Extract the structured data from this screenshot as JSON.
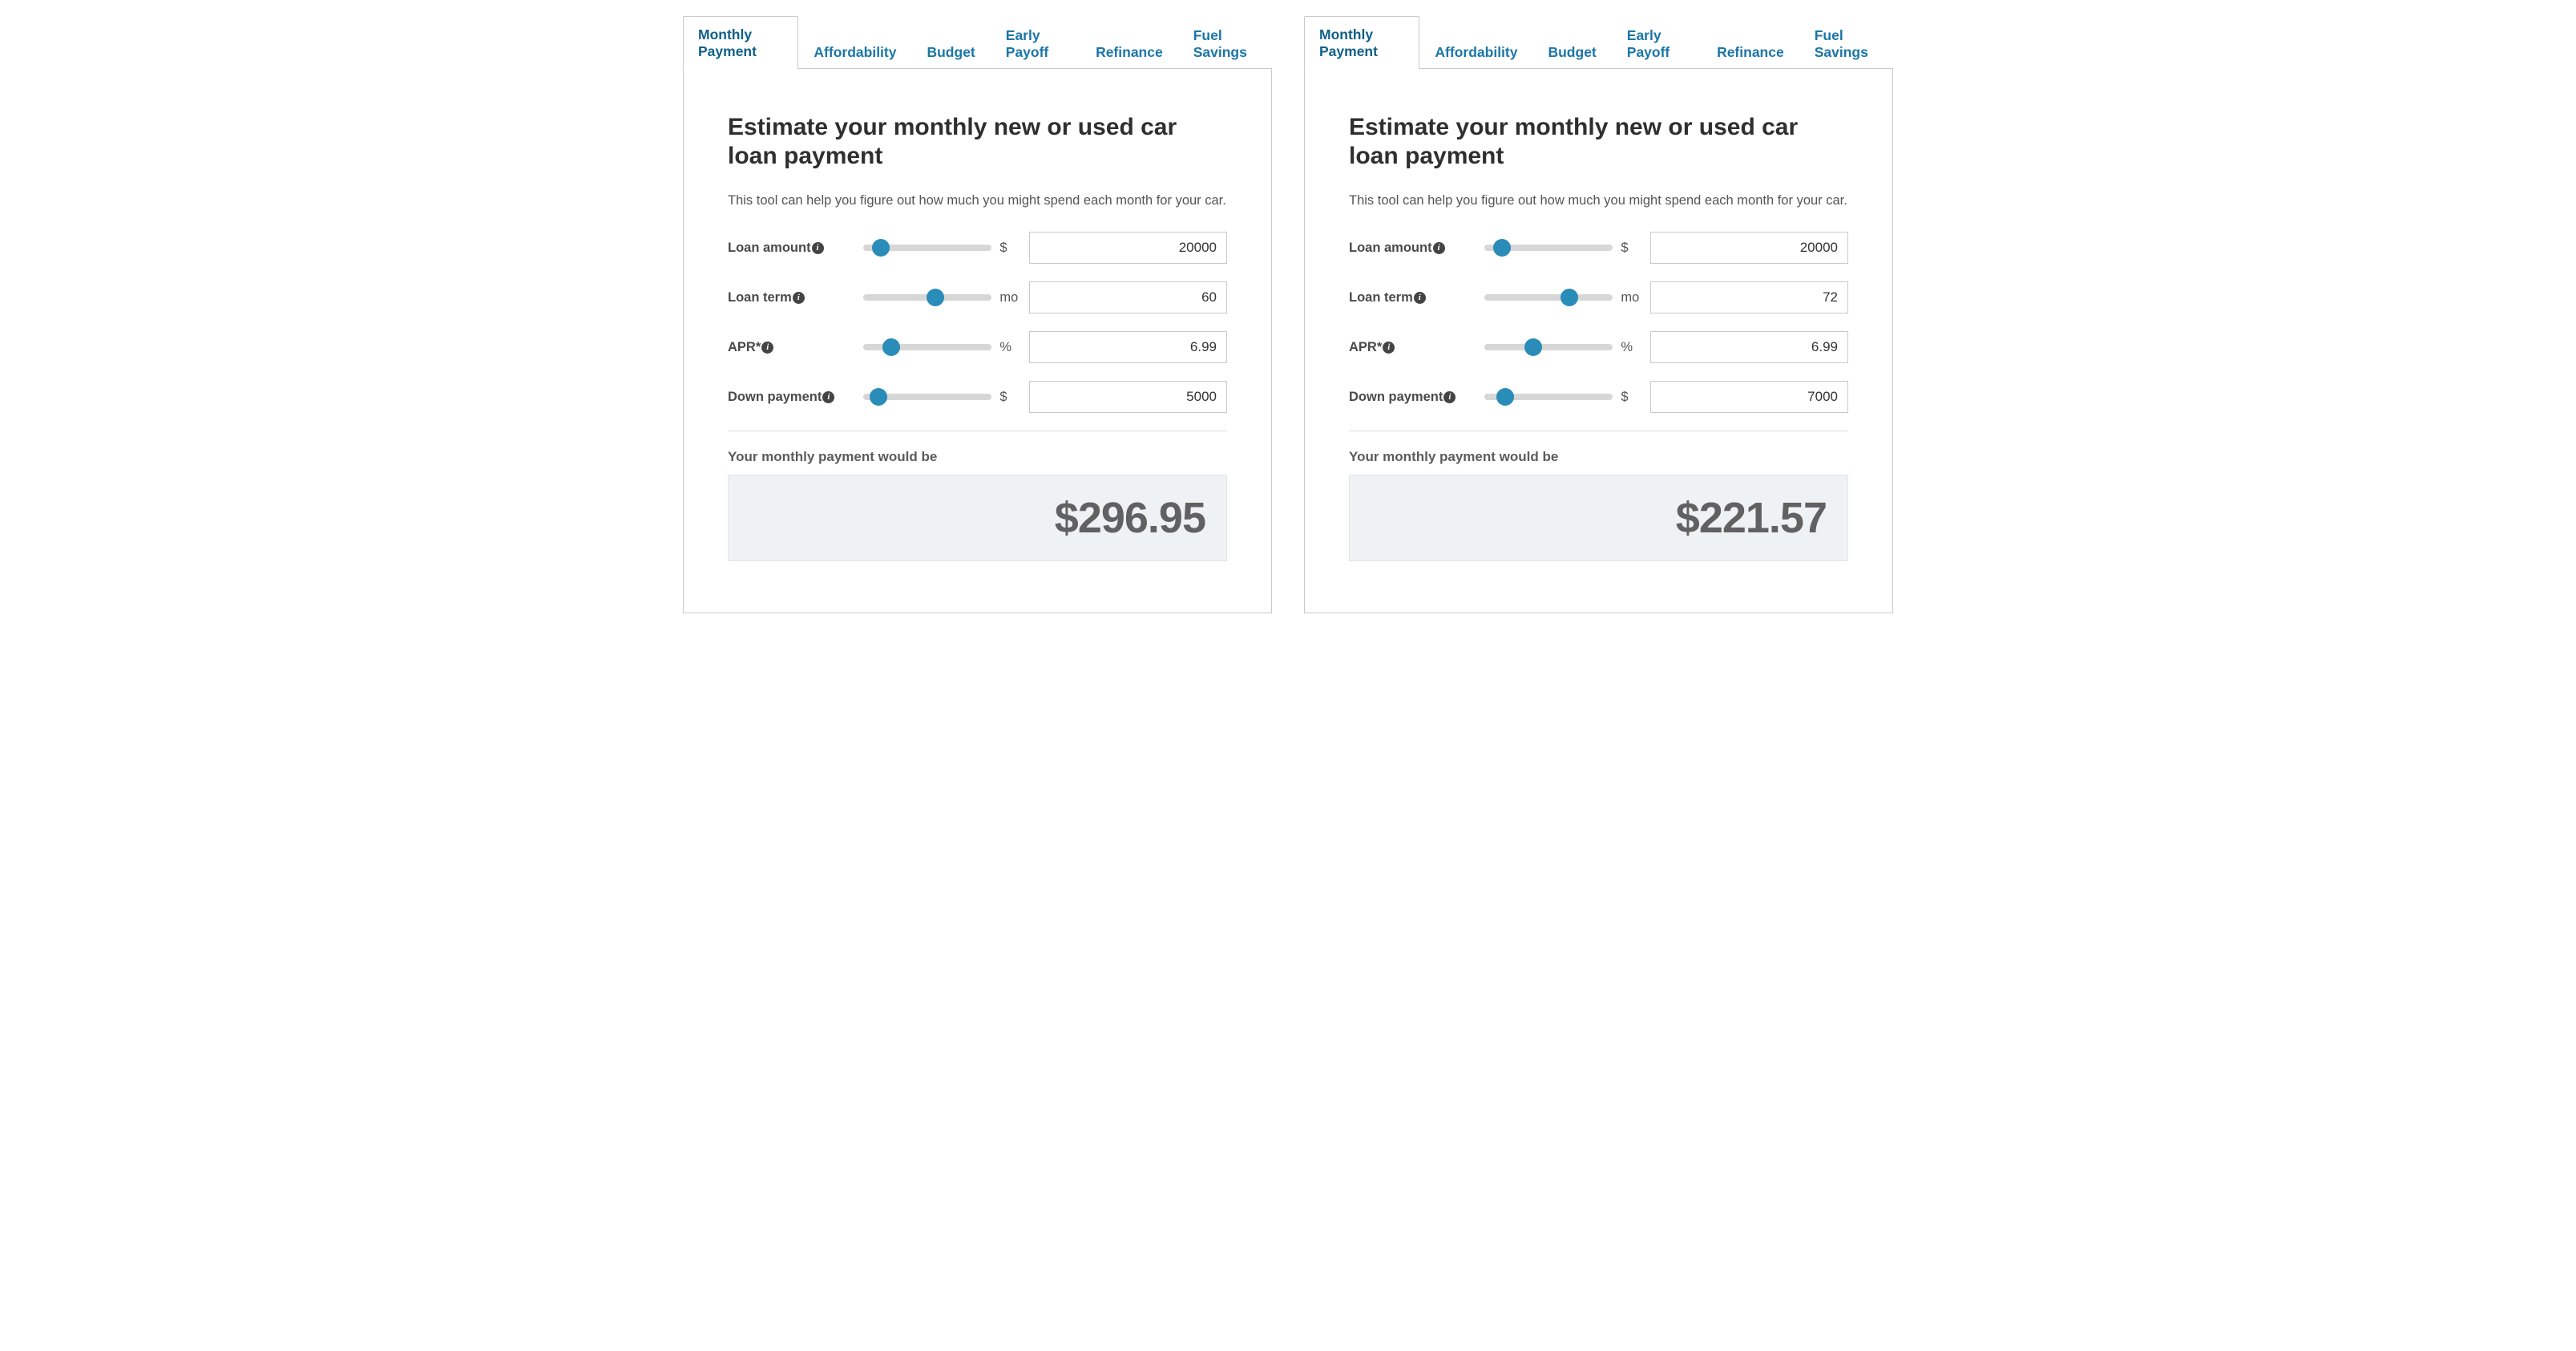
{
  "panels": [
    {
      "tabs": [
        {
          "label": "Monthly Payment",
          "active": true
        },
        {
          "label": "Affordability",
          "active": false
        },
        {
          "label": "Budget",
          "active": false
        },
        {
          "label": "Early Payoff",
          "active": false
        },
        {
          "label": "Refinance",
          "active": false
        },
        {
          "label": "Fuel Savings",
          "active": false
        }
      ],
      "title": "Estimate your monthly new or used car loan payment",
      "subtitle": "This tool can help you figure out how much you might spend each month for your car.",
      "fields": [
        {
          "label": "Loan amount",
          "unit": "$",
          "value": "20000",
          "slider_pct": 14
        },
        {
          "label": "Loan term",
          "unit": "mo",
          "value": "60",
          "slider_pct": 56
        },
        {
          "label": "APR*",
          "unit": "%",
          "value": "6.99",
          "slider_pct": 22
        },
        {
          "label": "Down payment",
          "unit": "$",
          "value": "5000",
          "slider_pct": 12
        }
      ],
      "result_label": "Your monthly payment would be",
      "result_value": "$296.95"
    },
    {
      "tabs": [
        {
          "label": "Monthly Payment",
          "active": true
        },
        {
          "label": "Affordability",
          "active": false
        },
        {
          "label": "Budget",
          "active": false
        },
        {
          "label": "Early Payoff",
          "active": false
        },
        {
          "label": "Refinance",
          "active": false
        },
        {
          "label": "Fuel Savings",
          "active": false
        }
      ],
      "title": "Estimate your monthly new or used car loan payment",
      "subtitle": "This tool can help you figure out how much you might spend each month for your car.",
      "fields": [
        {
          "label": "Loan amount",
          "unit": "$",
          "value": "20000",
          "slider_pct": 14
        },
        {
          "label": "Loan term",
          "unit": "mo",
          "value": "72",
          "slider_pct": 66
        },
        {
          "label": "APR*",
          "unit": "%",
          "value": "6.99",
          "slider_pct": 38
        },
        {
          "label": "Down payment",
          "unit": "$",
          "value": "7000",
          "slider_pct": 16
        }
      ],
      "result_label": "Your monthly payment would be",
      "result_value": "$221.57"
    }
  ]
}
